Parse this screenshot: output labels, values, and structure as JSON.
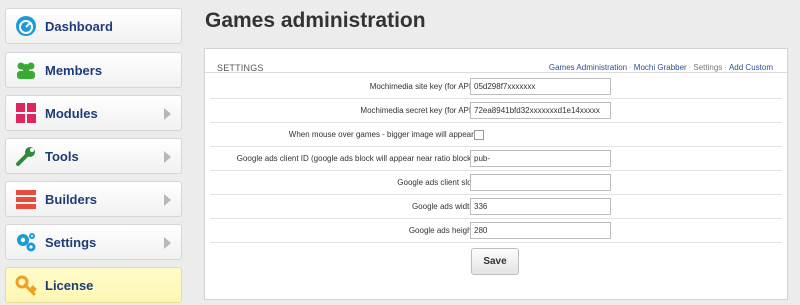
{
  "sidebar": {
    "items": [
      {
        "label": "Dashboard",
        "icon": "dashboard-icon",
        "color": "#1a9bd7"
      },
      {
        "label": "Members",
        "icon": "members-icon",
        "color": "#3aaa35"
      },
      {
        "label": "Modules",
        "icon": "modules-icon",
        "color": "#e0245e"
      },
      {
        "label": "Tools",
        "icon": "wrench-icon",
        "color": "#2e8b3a"
      },
      {
        "label": "Builders",
        "icon": "builders-icon",
        "color": "#e84c3d"
      },
      {
        "label": "Settings",
        "icon": "gears-icon",
        "color": "#1a9bd7"
      },
      {
        "label": "License",
        "icon": "key-icon",
        "color": "#f0a020"
      }
    ]
  },
  "main": {
    "title": "Games administration",
    "panel_title": "SETTINGS",
    "breadcrumbs": [
      "Games Administration",
      "Mochi Grabber",
      "Settings",
      "Add Custom"
    ],
    "fields": [
      {
        "label": "Mochimedia site key (for API):",
        "value": "05d298f7xxxxxxx"
      },
      {
        "label": "Mochimedia secret key (for API):",
        "value": "72ea8941bfd32xxxxxxxd1e14xxxxx"
      },
      {
        "label": "When mouse over games - bigger image will appear:",
        "checked": false
      },
      {
        "label": "Google ads client ID (google ads block will appear near ratio block):",
        "value": "pub-"
      },
      {
        "label": "Google ads client slot:",
        "value": ""
      },
      {
        "label": "Google ads width:",
        "value": "336"
      },
      {
        "label": "Google ads height:",
        "value": "280"
      }
    ],
    "save_label": "Save"
  }
}
